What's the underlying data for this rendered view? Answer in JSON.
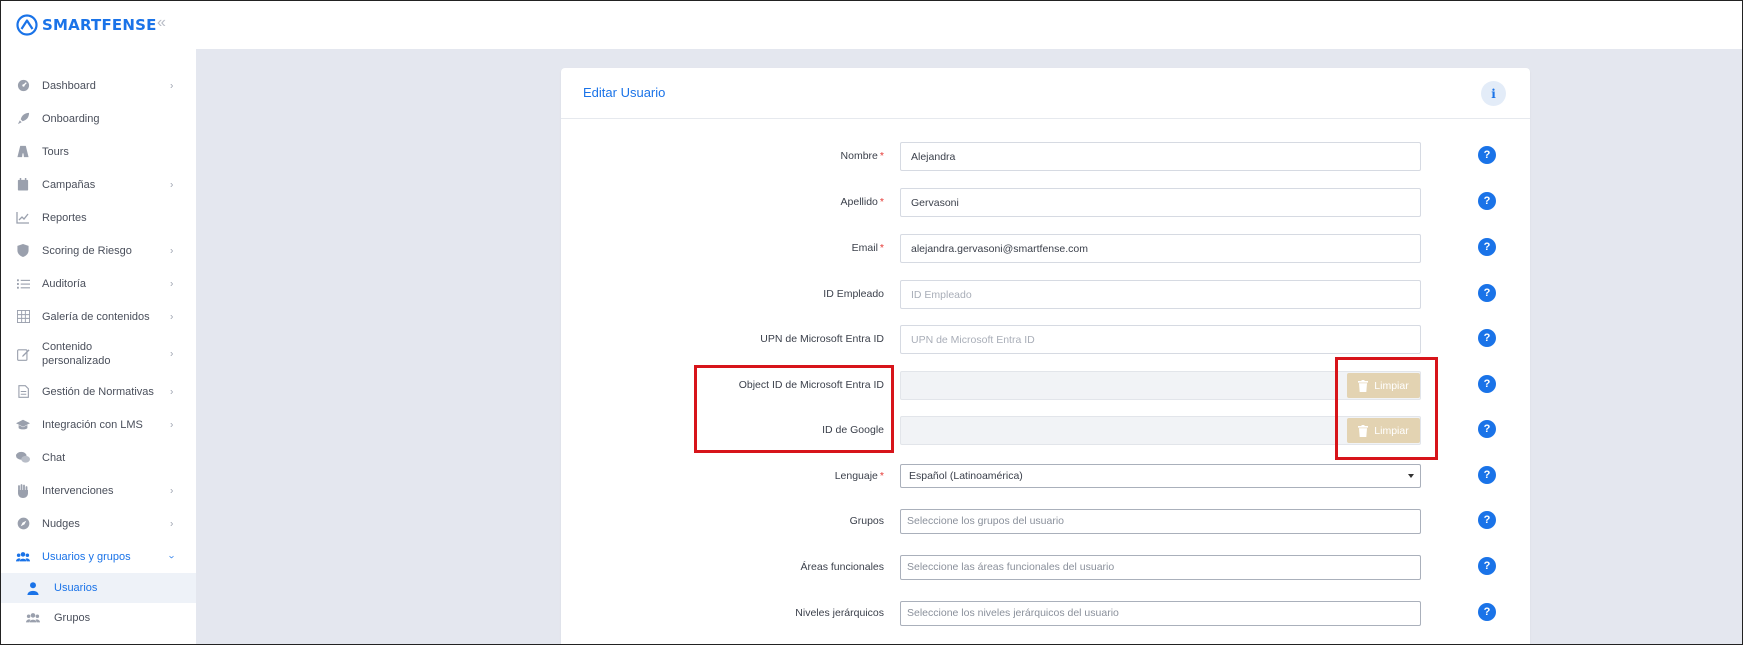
{
  "brand": {
    "name": "SMARTFENSE"
  },
  "sidebar": {
    "items": [
      {
        "label": "Dashboard",
        "icon": "gauge-icon",
        "has_children": true
      },
      {
        "label": "Onboarding",
        "icon": "rocket-icon",
        "has_children": false
      },
      {
        "label": "Tours",
        "icon": "road-icon",
        "has_children": false
      },
      {
        "label": "Campañas",
        "icon": "calendar-icon",
        "has_children": true
      },
      {
        "label": "Reportes",
        "icon": "line-chart-icon",
        "has_children": false
      },
      {
        "label": "Scoring de Riesgo",
        "icon": "shield-icon",
        "has_children": true
      },
      {
        "label": "Auditoría",
        "icon": "list-icon",
        "has_children": true
      },
      {
        "label": "Galería de contenidos",
        "icon": "grid-icon",
        "has_children": true
      },
      {
        "label": "Contenido personalizado",
        "icon": "edit-icon",
        "has_children": true
      },
      {
        "label": "Gestión de Normativas",
        "icon": "document-icon",
        "has_children": true
      },
      {
        "label": "Integración con LMS",
        "icon": "graduation-cap-icon",
        "has_children": true
      },
      {
        "label": "Chat",
        "icon": "chat-icon",
        "has_children": false
      },
      {
        "label": "Intervenciones",
        "icon": "hand-icon",
        "has_children": true
      },
      {
        "label": "Nudges",
        "icon": "compass-icon",
        "has_children": true
      },
      {
        "label": "Usuarios y grupos",
        "icon": "users-icon",
        "has_children": true,
        "active": true
      }
    ],
    "sub_items": [
      {
        "label": "Usuarios",
        "icon": "user-icon",
        "active": true
      },
      {
        "label": "Grupos",
        "icon": "group-icon",
        "active": false
      }
    ]
  },
  "card": {
    "title": "Editar Usuario",
    "info_glyph": "i",
    "help_glyph": "?",
    "clear_label": "Limpiar",
    "fields": {
      "nombre": {
        "label": "Nombre",
        "value": "Alejandra",
        "required": "*"
      },
      "apellido": {
        "label": "Apellido",
        "value": "Gervasoni",
        "required": "*"
      },
      "email": {
        "label": "Email",
        "value": "alejandra.gervasoni@smartfense.com",
        "required": "*"
      },
      "id_empleado": {
        "label": "ID Empleado",
        "placeholder": "ID Empleado"
      },
      "upn": {
        "label": "UPN de Microsoft Entra ID",
        "placeholder": "UPN de Microsoft Entra ID"
      },
      "object_id": {
        "label": "Object ID de Microsoft Entra ID",
        "value": ""
      },
      "google_id": {
        "label": "ID de Google",
        "value": ""
      },
      "lenguaje": {
        "label": "Lenguaje",
        "value": "Español (Latinoamérica)",
        "required": "*"
      },
      "grupos": {
        "label": "Grupos",
        "placeholder": "Seleccione los grupos del usuario"
      },
      "areas": {
        "label": "Áreas funcionales",
        "placeholder": "Seleccione las áreas funcionales del usuario"
      },
      "niveles": {
        "label": "Niveles jerárquicos",
        "placeholder": "Seleccione los niveles jerárquicos del usuario"
      }
    }
  },
  "colors": {
    "accent": "#1a73e8",
    "highlight": "#d7141a",
    "clear_button": "#e3d3b2"
  }
}
